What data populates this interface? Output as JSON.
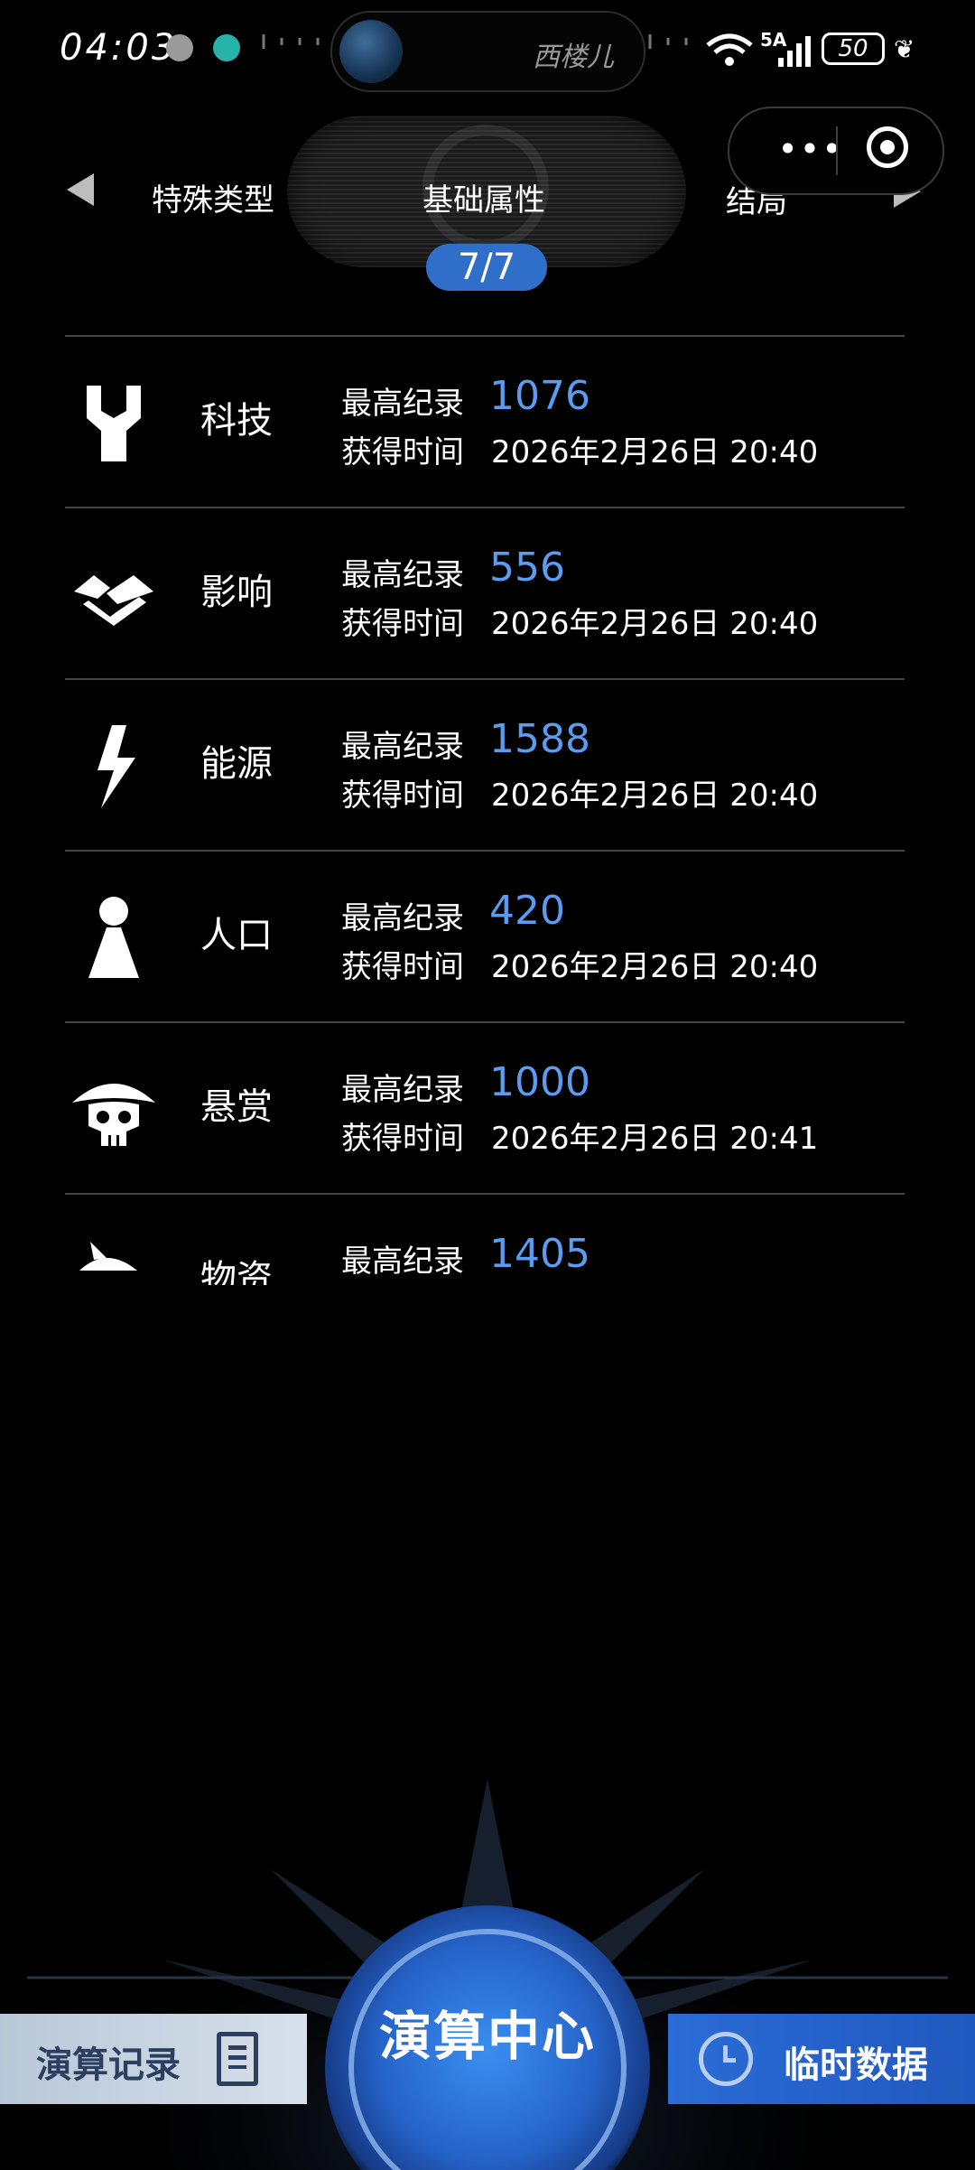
{
  "status_bar": {
    "time": "04:03",
    "island_text": "西楼儿",
    "network": "5A",
    "battery": "50"
  },
  "tabs": {
    "prev": "特殊类型",
    "current": "基础属性",
    "next": "结局",
    "page": "7/7"
  },
  "capsule": {
    "more": "•••"
  },
  "labels": {
    "record": "最高纪录",
    "time": "获得时间"
  },
  "records": [
    {
      "name": "科技",
      "icon": "wrench-icon",
      "value": "1076",
      "date": "2026年2月26日 20:40"
    },
    {
      "name": "影响",
      "icon": "handshake-icon",
      "value": "556",
      "date": "2026年2月26日 20:40"
    },
    {
      "name": "能源",
      "icon": "lightning-icon",
      "value": "1588",
      "date": "2026年2月26日 20:40"
    },
    {
      "name": "人口",
      "icon": "person-icon",
      "value": "420",
      "date": "2026年2月26日 20:40"
    },
    {
      "name": "悬赏",
      "icon": "pirate-skull-icon",
      "value": "1000",
      "date": "2026年2月26日 20:41"
    },
    {
      "name": "物资",
      "icon": "supplies-icon",
      "value": "1405"
    }
  ],
  "bottom_nav": {
    "left": "演算记录",
    "center": "演算中心",
    "right": "临时数据"
  },
  "colors": {
    "accent": "#5b9bf0",
    "badge": "#2f6fc9",
    "nav_right": "#2b6cd6"
  }
}
